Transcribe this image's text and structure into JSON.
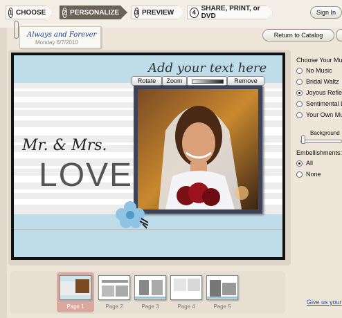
{
  "steps": [
    {
      "num": "1",
      "label": "CHOOSE"
    },
    {
      "num": "2",
      "label": "PERSONALIZE"
    },
    {
      "num": "3",
      "label": "PREVIEW"
    },
    {
      "num": "4",
      "label": "SHARE, PRINT, or DVD"
    }
  ],
  "header": {
    "sign_in": "Sign In",
    "return_catalog": "Return to Catalog"
  },
  "project": {
    "title": "Always and Forever",
    "date": "Monday 6/7/2010"
  },
  "canvas": {
    "add_text": "Add your text here",
    "mr_mrs": "Mr. & Mrs.",
    "love": "LOVE",
    "photo_tools": {
      "rotate": "Rotate",
      "zoom": "Zoom",
      "remove": "Remove"
    }
  },
  "music": {
    "heading": "Choose Your Musi",
    "options": [
      "No Music",
      "Bridal Waltz",
      "Joyous Reflec",
      "Sentimental L",
      "Your Own Mus"
    ],
    "selected": "Joyous Reflec"
  },
  "background": {
    "label": "Background"
  },
  "embellishments": {
    "heading": "Embellishments:",
    "options": [
      "All",
      "None"
    ],
    "selected": "All"
  },
  "pages": [
    "Page 1",
    "Page 2",
    "Page 3",
    "Page 4",
    "Page 5"
  ],
  "feedback_link": "Give us your",
  "colors": {
    "accent_step": "#6b6256",
    "page_bg": "#bfdde8",
    "link": "#1a4fcf"
  }
}
